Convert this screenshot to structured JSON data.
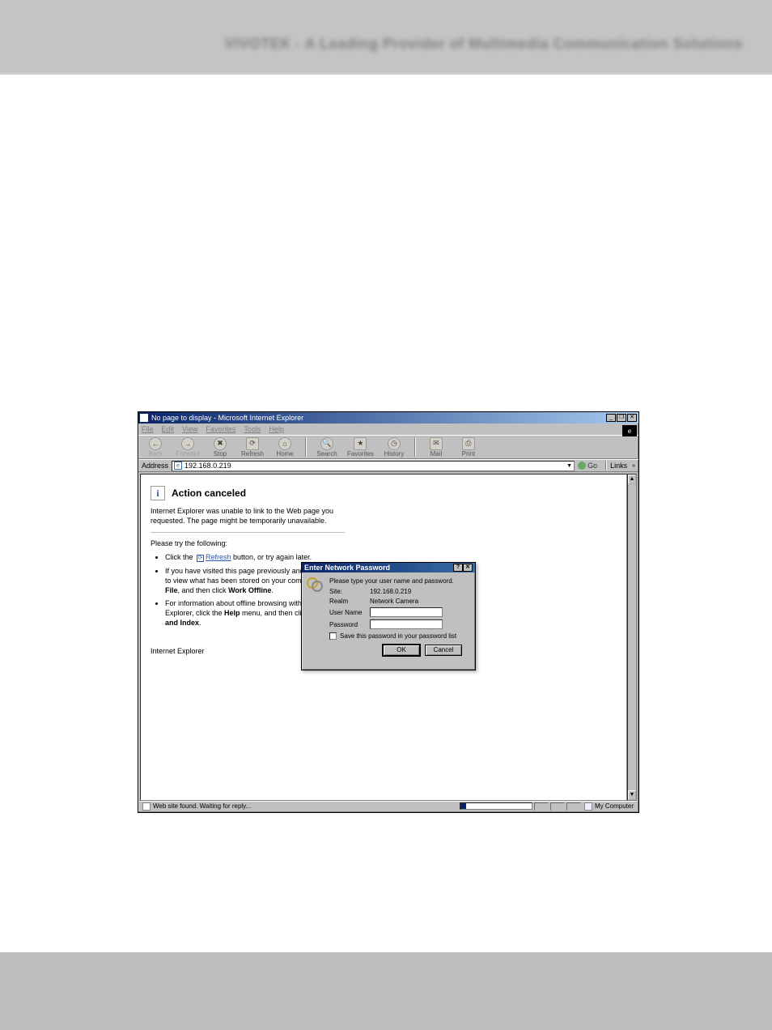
{
  "header": {
    "blur_text": "VIVOTEK - A Leading Provider of Multimedia Communication Solutions"
  },
  "ie": {
    "title": "No page to display - Microsoft Internet Explorer",
    "menu": {
      "file": "File",
      "edit": "Edit",
      "view": "View",
      "favorites": "Favorites",
      "tools": "Tools",
      "help": "Help"
    },
    "toolbar": {
      "back": "Back",
      "forward": "Forward",
      "stop": "Stop",
      "refresh": "Refresh",
      "home": "Home",
      "search": "Search",
      "favorites": "Favorites",
      "history": "History",
      "mail": "Mail",
      "print": "Print"
    },
    "address_label": "Address",
    "address_value": "192.168.0.219",
    "go_label": "Go",
    "links_label": "Links",
    "content": {
      "title": "Action canceled",
      "desc": "Internet Explorer was unable to link to the Web page you requested. The page might be temporarily unavailable.",
      "try_label": "Please try the following:",
      "refresh_link": "Refresh",
      "bullet1_pre": "Click the ",
      "bullet1_post": " button, or try again later.",
      "bullet2": "If you have visited this page previously and you want to view what has been stored on your computer, click File, and then click Work Offline.",
      "bullet2_bold": "Work Offline",
      "bullet3_pre": "For information about offline browsing with Internet Explorer, click the ",
      "bullet3_help": "Help",
      "bullet3_mid": " menu, and then click ",
      "bullet3_contents": "Contents and Index",
      "bullet3_post": ".",
      "sig": "Internet Explorer"
    },
    "status": {
      "text": "Web site found. Waiting for reply...",
      "zone": "My Computer"
    }
  },
  "dialog": {
    "title": "Enter Network Password",
    "instruction": "Please type your user name and password.",
    "site_label": "Site:",
    "site_value": "192.168.0.219",
    "realm_label": "Realm",
    "realm_value": "Network Camera",
    "user_label": "User Name",
    "pass_label": "Password",
    "save_label": "Save this password in your password list",
    "ok": "OK",
    "cancel": "Cancel"
  }
}
